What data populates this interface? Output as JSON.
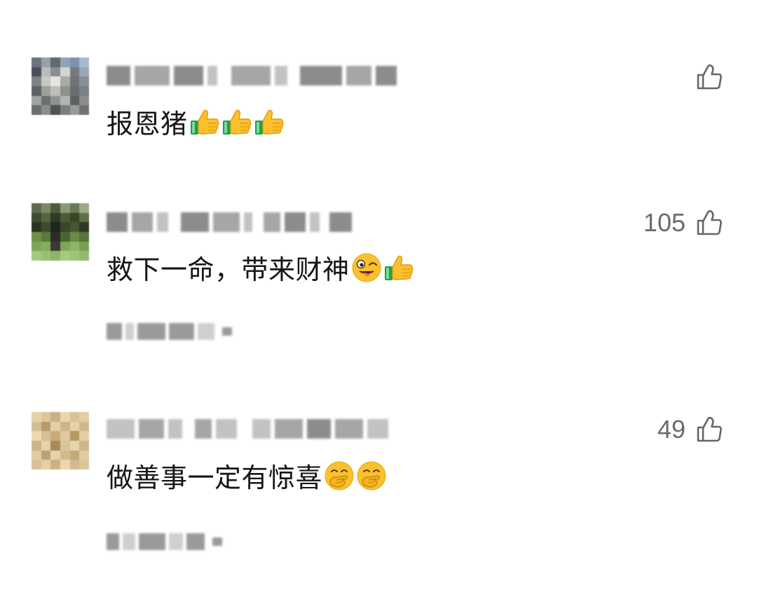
{
  "comments": [
    {
      "text": "报恩猪",
      "emojis": [
        "thumbs-up",
        "thumbs-up",
        "thumbs-up"
      ],
      "like_count": ""
    },
    {
      "text": "救下一命，带来财神",
      "emojis": [
        "winking-tongue-face",
        "thumbs-up"
      ],
      "like_count": "105"
    },
    {
      "text": "做善事一定有惊喜",
      "emojis": [
        "hand-over-mouth-face",
        "hand-over-mouth-face"
      ],
      "like_count": "49"
    }
  ],
  "icons": {
    "like": "thumb-up-outline-icon",
    "thumbs_up_emoji": "thumbs-up",
    "wink_emoji": "winking-face-with-tongue",
    "giggle_emoji": "face-with-hand-over-mouth"
  },
  "colors": {
    "text": "#161616",
    "muted": "#6b6b6b",
    "emoji_yellow": "#fbc02d",
    "emoji_green": "#19a34a"
  }
}
